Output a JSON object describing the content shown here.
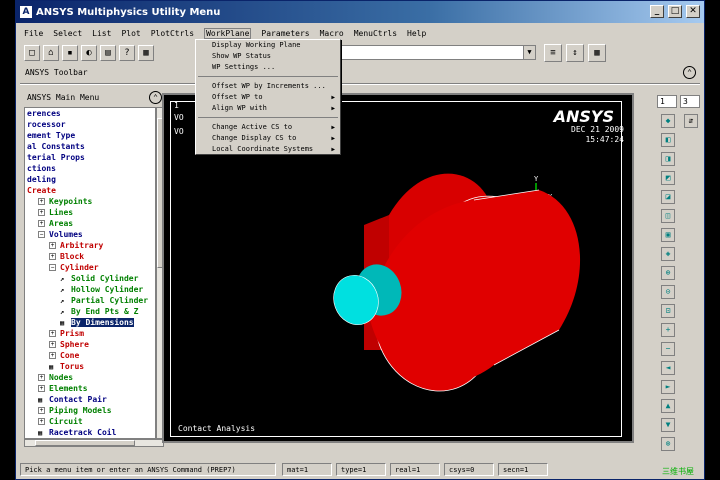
{
  "window": {
    "title": "ANSYS Multiphysics Utility Menu"
  },
  "menubar": [
    "File",
    "Select",
    "List",
    "Plot",
    "PlotCtrls",
    "WorkPlane",
    "Parameters",
    "Macro",
    "MenuCtrls",
    "Help"
  ],
  "workplane_menu": {
    "items": [
      {
        "label": "Display Working Plane",
        "arrow": ""
      },
      {
        "label": "Show WP Status",
        "arrow": ""
      },
      {
        "label": "WP Settings ...",
        "arrow": ""
      },
      {
        "label": "Offset WP by Increments ...",
        "arrow": ""
      },
      {
        "label": "Offset WP to",
        "arrow": "▶"
      },
      {
        "label": "Align WP with",
        "arrow": "▶"
      },
      {
        "label": "Change Active CS to",
        "arrow": "▶"
      },
      {
        "label": "Change Display CS to",
        "arrow": "▶"
      },
      {
        "label": "Local Coordinate Systems",
        "arrow": "▶"
      }
    ]
  },
  "toolbar": {
    "label": "ANSYS Toolbar"
  },
  "main_menu": {
    "title": "ANSYS Main Menu",
    "items": [
      {
        "label": "erences",
        "style": "blue",
        "indent": 0,
        "pm": "",
        "icon": ""
      },
      {
        "label": "rocessor",
        "style": "blue",
        "indent": 0,
        "pm": "",
        "icon": ""
      },
      {
        "label": "ement Type",
        "style": "blue",
        "indent": 0,
        "pm": "",
        "icon": ""
      },
      {
        "label": "al Constants",
        "style": "blue",
        "indent": 0,
        "pm": "",
        "icon": ""
      },
      {
        "label": "terial Props",
        "style": "blue",
        "indent": 0,
        "pm": "",
        "icon": ""
      },
      {
        "label": "ctions",
        "style": "blue",
        "indent": 0,
        "pm": "",
        "icon": ""
      },
      {
        "label": "deling",
        "style": "blue",
        "indent": 0,
        "pm": "",
        "icon": ""
      },
      {
        "label": "Create",
        "style": "red",
        "indent": 0,
        "pm": "",
        "icon": ""
      },
      {
        "label": "Keypoints",
        "style": "green",
        "indent": 1,
        "pm": "+",
        "icon": ""
      },
      {
        "label": "Lines",
        "style": "green",
        "indent": 1,
        "pm": "+",
        "icon": ""
      },
      {
        "label": "Areas",
        "style": "green",
        "indent": 1,
        "pm": "+",
        "icon": ""
      },
      {
        "label": "Volumes",
        "style": "blue",
        "indent": 1,
        "pm": "−",
        "icon": ""
      },
      {
        "label": "Arbitrary",
        "style": "red",
        "indent": 2,
        "pm": "+",
        "icon": ""
      },
      {
        "label": "Block",
        "style": "red",
        "indent": 2,
        "pm": "+",
        "icon": ""
      },
      {
        "label": "Cylinder",
        "style": "red",
        "indent": 2,
        "pm": "−",
        "icon": ""
      },
      {
        "label": "Solid Cylinder",
        "style": "green",
        "indent": 3,
        "pm": "",
        "icon": "↗"
      },
      {
        "label": "Hollow Cylinder",
        "style": "green",
        "indent": 3,
        "pm": "",
        "icon": "↗"
      },
      {
        "label": "Partial Cylinder",
        "style": "green",
        "indent": 3,
        "pm": "",
        "icon": "↗"
      },
      {
        "label": "By End Pts & Z",
        "style": "green",
        "indent": 3,
        "pm": "",
        "icon": "↗"
      },
      {
        "label": "By Dimensions",
        "style": "sel",
        "indent": 3,
        "pm": "",
        "icon": "▦"
      },
      {
        "label": "Prism",
        "style": "red",
        "indent": 2,
        "pm": "+",
        "icon": ""
      },
      {
        "label": "Sphere",
        "style": "red",
        "indent": 2,
        "pm": "+",
        "icon": ""
      },
      {
        "label": "Cone",
        "style": "red",
        "indent": 2,
        "pm": "+",
        "icon": ""
      },
      {
        "label": "Torus",
        "style": "red",
        "indent": 2,
        "pm": "",
        "icon": "▦"
      },
      {
        "label": "Nodes",
        "style": "green",
        "indent": 1,
        "pm": "+",
        "icon": ""
      },
      {
        "label": "Elements",
        "style": "green",
        "indent": 1,
        "pm": "+",
        "icon": ""
      },
      {
        "label": "Contact Pair",
        "style": "blue",
        "indent": 1,
        "pm": "",
        "icon": "▦"
      },
      {
        "label": "Piping Models",
        "style": "green",
        "indent": 1,
        "pm": "+",
        "icon": ""
      },
      {
        "label": "Circuit",
        "style": "green",
        "indent": 1,
        "pm": "+",
        "icon": ""
      },
      {
        "label": "Racetrack Coil",
        "style": "blue",
        "indent": 1,
        "pm": "",
        "icon": "▦"
      }
    ]
  },
  "graphics": {
    "window_number": "1",
    "label_vo1": "VO",
    "label_vo2": "VO",
    "brand": "ANSYS",
    "date": "DEC 21 2009",
    "time": "15:47:24",
    "axis_y": "Y",
    "axis_x": "X",
    "footer": "Contact Analysis",
    "colors": {
      "outer_cylinder": "#e00000",
      "inner_cylinder": "#00c8c8"
    }
  },
  "right_panel": {
    "window_select": "1",
    "view_select": "3"
  },
  "status_bar": {
    "prompt": "Pick a menu item or enter an ANSYS Command (PREP7)",
    "mat": "mat=1",
    "type": "type=1",
    "real": "real=1",
    "csys": "csys=0",
    "secn": "secn=1"
  },
  "watermark": "三维书屋"
}
